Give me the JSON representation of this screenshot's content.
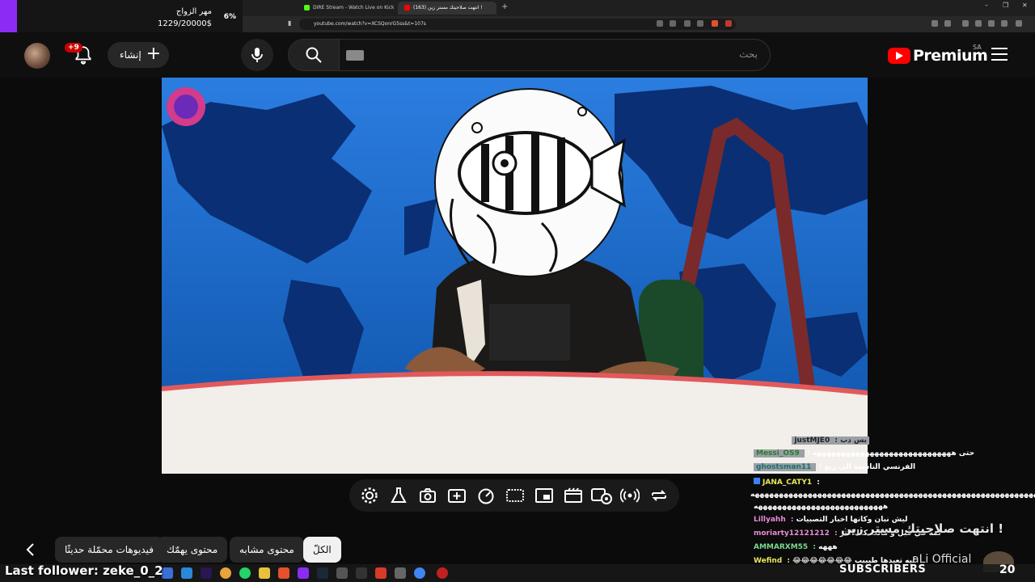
{
  "browser": {
    "tabs": [
      {
        "title": "DIRE Stream - Watch Live on Kick",
        "icon_color": "#53fc18",
        "active": false
      },
      {
        "title": "(163) انتهت صلاحيتك مستر زين !",
        "icon_color": "#ff0000",
        "active": true
      }
    ],
    "new_tab": "+",
    "close_tab": "×",
    "url": "youtube.com/watch?v=XCSQonrG5ss&t=107s",
    "win_min": "–",
    "win_max": "❐",
    "win_close": "✕"
  },
  "goal_widget": {
    "label": "مهر الزواج",
    "count": "1229/20000$",
    "percent": "6%",
    "bar_fraction": 0.06,
    "accent": "#8b2cf5"
  },
  "header": {
    "create_label": "إنشاء",
    "notif_badge": "+9",
    "search_placeholder": "بحث",
    "logo_text": "Premium",
    "country": "SA"
  },
  "player_controls": [
    "settings-icon",
    "lab-icon",
    "screenshot-icon",
    "sparkle-icon",
    "speed-icon",
    "subtitles-icon",
    "miniplayer-icon",
    "theater-icon",
    "auto-icon",
    "broadcast-icon",
    "loop-icon"
  ],
  "chips": {
    "all": "الكلّ",
    "similar": "محتوى مشابه",
    "for_you": "محتوى يهمّك",
    "recent": "فيديوهات محمّلة حديثًا"
  },
  "chat": [
    {
      "user": "justMJE0",
      "text": "بس دب",
      "color": "#9aa0a6",
      "highlight": true
    },
    {
      "user": "Messi_OS9",
      "text": "حتى هههههههههههههههههههههههههههههه",
      "color": "#7bd88f",
      "highlight": true
    },
    {
      "user": "ghostsman11",
      "text": "الفرنسي التاسعة الى ربع",
      "color": "#2aa6a6",
      "highlight": true
    },
    {
      "user": "JANA_CATY1",
      "text": ":",
      "color": "#e8e85a",
      "highlight": false
    },
    {
      "user": "",
      "text": "هههههههههههههههههههههههههههههههههههههههههههههههههههههههههههههههههه",
      "color": "#ffffff",
      "highlight": false
    },
    {
      "user": "",
      "text": "هههههههههههههههههههههههههههه",
      "color": "#ffffff",
      "highlight": false
    },
    {
      "user": "Lillyahh",
      "text": "ليش نبان وكانها اخبار التصبيات",
      "color": "#e98bd6",
      "highlight": false
    },
    {
      "user": "moriarty12121212",
      "text": "لمه في قبل و مالت كذا اكثر",
      "color": "#e98bd6",
      "highlight": false
    },
    {
      "user": "AMMARXM55",
      "text": "هههه",
      "color": "#7bd88f",
      "highlight": false
    },
    {
      "user": "Wefind",
      "text": "😂😂😂😂😂😂😂 ليه تعيدها طيببب",
      "color": "#e8e85a",
      "highlight": false
    }
  ],
  "overlay": {
    "last_follower": "Last follower: zeke_0_2",
    "banner_text": "انتهت صلاحيتك مستر زين !",
    "channel_name": "aLi Official",
    "subscribers_label": "SUBSCRIBERS",
    "subscribers_count": "20"
  }
}
